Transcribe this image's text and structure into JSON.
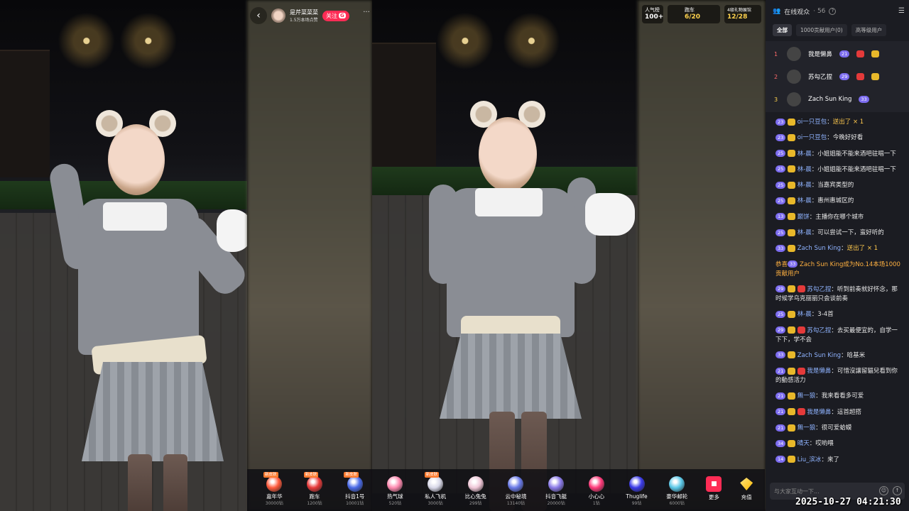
{
  "streamer": {
    "name": "是芹菜菜菜",
    "subtitle": "1.5万本场点赞",
    "follow_label": "关注",
    "follow_badge": "G",
    "back_icon": "chevron-left-icon",
    "more_label": "···"
  },
  "top_badges": {
    "popularity_label": "人气榜",
    "popularity_value": "100+",
    "car_label": "跑车",
    "car_value": "6/20",
    "gift_label": "4级礼物展馆",
    "gift_value": "12/28"
  },
  "gifts": [
    {
      "name": "嘉年华",
      "price": "30000钻",
      "tag": "新皮肤",
      "color": "#ff5a3c"
    },
    {
      "name": "跑车",
      "price": "1200钻",
      "tag": "新皮肤",
      "color": "#e83a3a"
    },
    {
      "name": "抖音1号",
      "price": "10001钻",
      "tag": "新皮肤",
      "color": "#4a6ae8"
    },
    {
      "name": "热气球",
      "price": "520钻",
      "tag": "",
      "color": "#ff8ab0"
    },
    {
      "name": "私人飞机",
      "price": "3000钻",
      "tag": "新皮肤",
      "color": "#d8d8e8"
    },
    {
      "name": "比心兔兔",
      "price": "299钻",
      "tag": "",
      "color": "#f0c8d8"
    },
    {
      "name": "云中秘境",
      "price": "13140钻",
      "tag": "",
      "color": "#6a7ae8"
    },
    {
      "name": "抖音飞艇",
      "price": "20000钻",
      "tag": "",
      "color": "#8a7ae8"
    },
    {
      "name": "小心心",
      "price": "1钻",
      "tag": "",
      "color": "#ff3a7a"
    },
    {
      "name": "Thuglife",
      "price": "99钻",
      "tag": "",
      "color": "#3a3ae8"
    },
    {
      "name": "豪华邮轮",
      "price": "6000钻",
      "tag": "",
      "color": "#5ac8e8"
    }
  ],
  "gift_more_label": "更多",
  "gift_recharge_label": "充值",
  "panel": {
    "title": "在线观众",
    "count": "· 56",
    "tabs": [
      "全部",
      "1000贡献用户(0)",
      "高等级用户"
    ],
    "ranks": [
      {
        "num": "1",
        "name": "我是懒鼻",
        "lv": "21"
      },
      {
        "num": "2",
        "name": "苏勾乙捏",
        "lv": "29"
      },
      {
        "num": "3",
        "name": "Zach Sun King",
        "lv": "33"
      }
    ],
    "input_placeholder": "与大家互动一下..."
  },
  "chat": [
    {
      "lv": "23",
      "name": "oi一只豆包",
      "text": "送出了",
      "extra": "× 1",
      "type": "gift"
    },
    {
      "lv": "23",
      "name": "oi一只豆包",
      "text": "今晚好好看",
      "type": "normal"
    },
    {
      "lv": "25",
      "name": "林-晨",
      "text": "小姐姐能不能来酒吧驻唱一下",
      "type": "normal"
    },
    {
      "lv": "25",
      "name": "林-晨",
      "text": "小姐姐能不能来酒吧驻唱一下",
      "type": "normal"
    },
    {
      "lv": "25",
      "name": "林-晨",
      "text": "当嘉宾类型的",
      "type": "normal"
    },
    {
      "lv": "25",
      "name": "林-晨",
      "text": "惠州惠城区的",
      "type": "normal"
    },
    {
      "lv": "13",
      "name": "巅饼",
      "text": "主播你在哪个城市",
      "type": "normal"
    },
    {
      "lv": "25",
      "name": "林-晨",
      "text": "可以尝试一下，蛮好听的",
      "type": "normal"
    },
    {
      "lv": "33",
      "name": "Zach Sun King",
      "text": "送出了",
      "extra": "× 1",
      "type": "gift"
    },
    {
      "lv": "33",
      "name": "恭喜",
      "text": "Zach Sun King成为No.14本场1000贡献用户",
      "type": "system"
    },
    {
      "lv": "29",
      "name": "苏勾乙捏",
      "text": "听到前奏就好怀念，那时候学乌克丽丽只会谈前奏",
      "type": "normal2"
    },
    {
      "lv": "25",
      "name": "林-晨",
      "text": "3-4首",
      "type": "normal"
    },
    {
      "lv": "29",
      "name": "苏勾乙捏",
      "text": "去买最便宜的，自学一下下，学不会",
      "type": "normal2"
    },
    {
      "lv": "33",
      "name": "Zach Sun King",
      "text": "晗基米",
      "type": "normal"
    },
    {
      "lv": "21",
      "name": "我是懒鼻",
      "text": "可惜沒讓留貓兒看到你的動感活力",
      "type": "normal2"
    },
    {
      "lv": "21",
      "name": "無一狼",
      "text": "我来看看多可爱",
      "type": "normal"
    },
    {
      "lv": "21",
      "name": "我是懒鼻",
      "text": "這首超搭",
      "type": "normal2"
    },
    {
      "lv": "21",
      "name": "無一狼",
      "text": "很可爱蛤蟆",
      "type": "normal"
    },
    {
      "lv": "34",
      "name": "晴天",
      "text": "哎哟喂",
      "type": "normal"
    },
    {
      "lv": "14",
      "name": "Liu_滨冰",
      "text": "来了",
      "type": "normal"
    }
  ],
  "timestamp": "2025-10-27 04:21:30"
}
